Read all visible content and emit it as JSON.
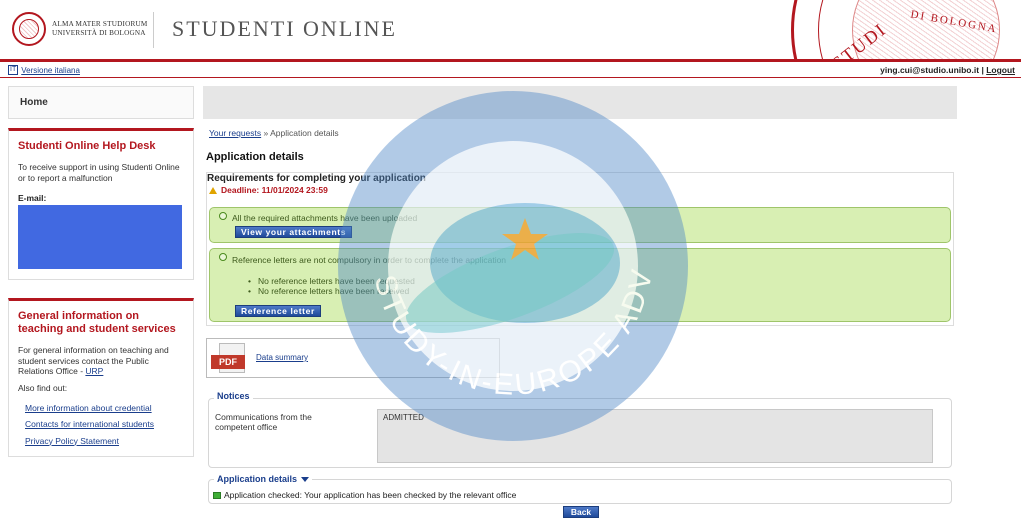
{
  "header": {
    "logo_line1": "ALMA MATER STUDIORUM",
    "logo_line2": "UNIVERSITÀ DI BOLOGNA",
    "app_title": "STUDENTI ONLINE",
    "seal_text_1": "STUDI",
    "seal_text_2": "DI BOLOGNA"
  },
  "topbar": {
    "lang_icon": "IT",
    "lang_link": "Versione italiana",
    "user_email": "ying.cui@studio.unibo.it",
    "separator": "|",
    "logout": "Logout"
  },
  "sidebar": {
    "home": "Home",
    "helpdesk": {
      "title": "Studenti Online Help Desk",
      "text": "To receive support in using Studenti Online or to report a malfunction",
      "email_label": "E-mail:"
    },
    "general": {
      "title": "General information on teaching and student services",
      "text_before": "For general information on teaching and student services contact the Public Relations Office - ",
      "urp_link": "URP",
      "also": "Also find out:",
      "links": [
        "More information about credential",
        "Contacts for international students",
        "Privacy Policy Statement"
      ]
    }
  },
  "main": {
    "breadcrumb_link": "Your requests",
    "breadcrumb_current": "» Application details",
    "page_title": "Application details",
    "requirements": {
      "title": "Requirements for completing your application",
      "deadline": "Deadline: 11/01/2024 23:59",
      "attachments_text": "All the required attachments have been uploaded",
      "attachments_button": "View your attachments",
      "reference_text": "Reference letters are not compulsory in order to complete the application",
      "reference_items": [
        "No reference letters have been requested",
        "No reference letters have been received"
      ],
      "reference_button": "Reference letter"
    },
    "pdf": {
      "icon_label": "PDF",
      "link": "Data summary"
    },
    "notices": {
      "legend": "Notices",
      "label": "Communications from the competent office",
      "value": "ADMITTED"
    },
    "details": {
      "legend": "Application details",
      "status": "Application checked: Your application has been checked by the relevant office"
    },
    "back_button": "Back"
  },
  "watermark": {
    "text": "STUDY-IN-EUROPE ADVISER",
    "icon": "globe-star-logo"
  },
  "colors": {
    "brand_red": "#b3171f",
    "link_blue": "#1a3e8c",
    "success_green_bg": "#d8efb3",
    "redaction_blue": "#4169e1"
  }
}
